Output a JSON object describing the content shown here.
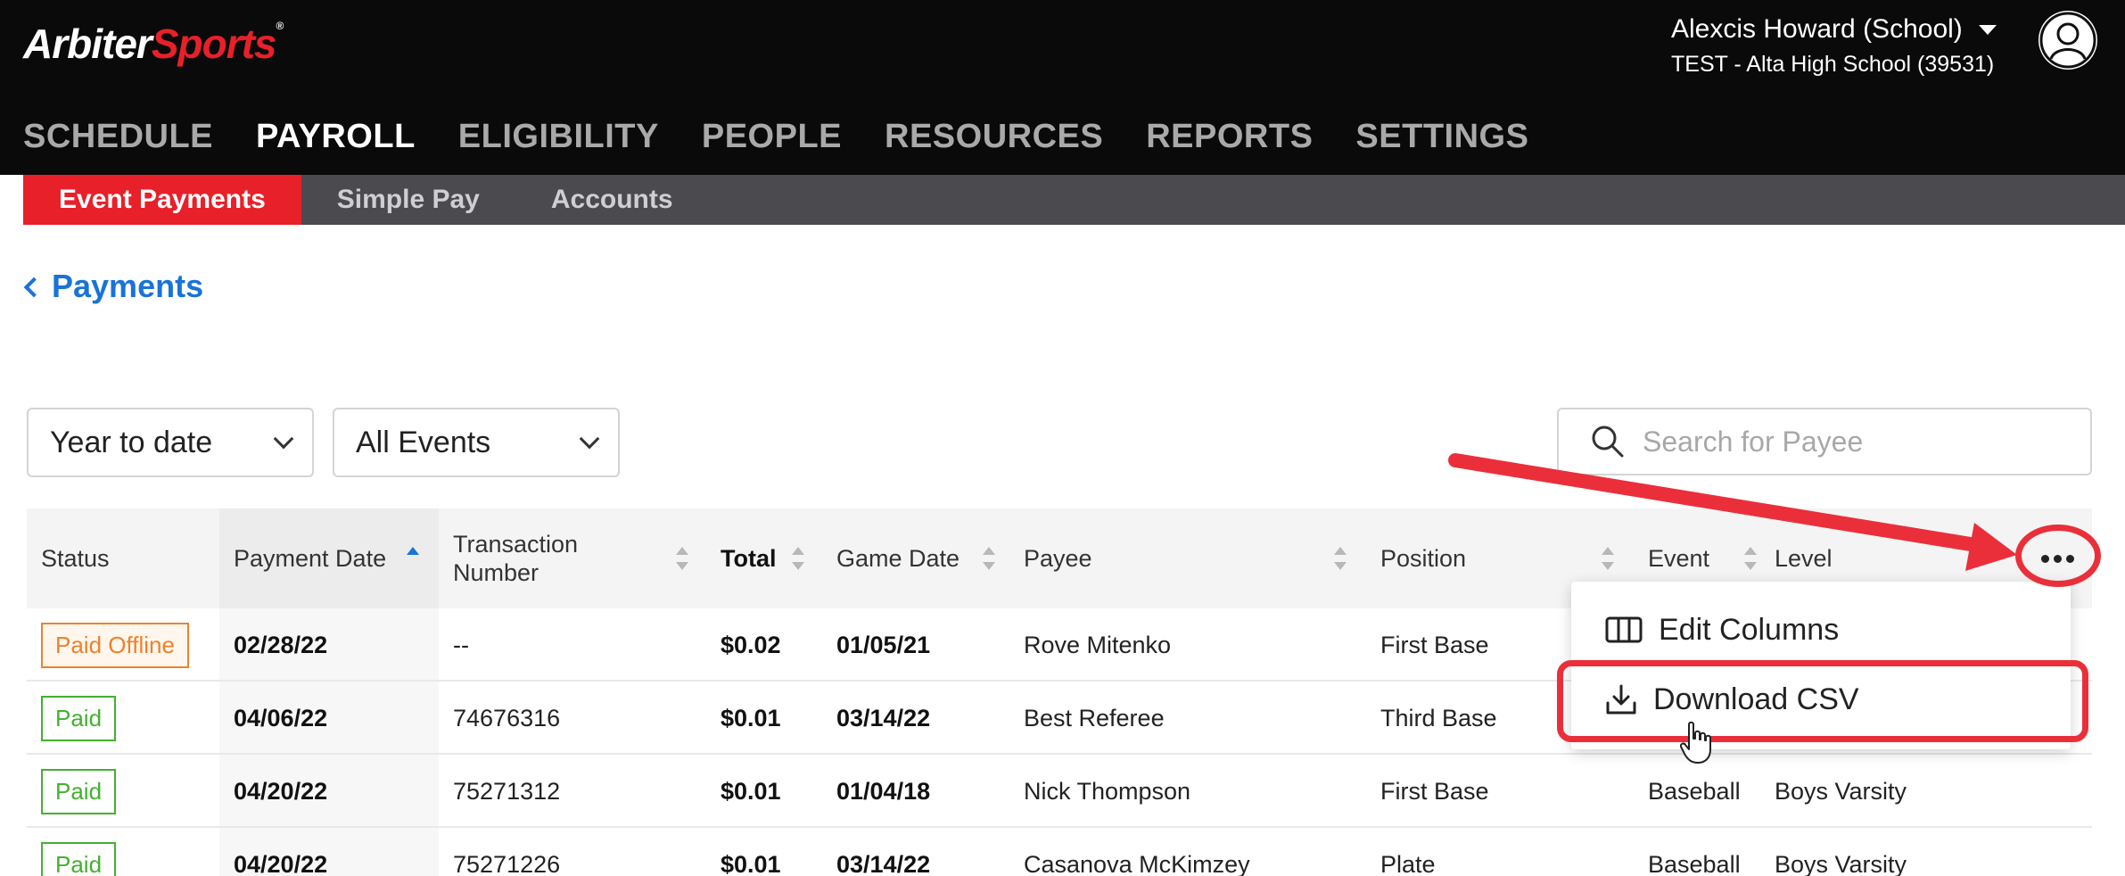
{
  "logo": {
    "part1": "Arbiter",
    "part2": "Sports",
    "mark": "®"
  },
  "user": {
    "name": "Alexcis Howard (School)",
    "school": "TEST - Alta High School (39531)"
  },
  "main_nav": [
    "SCHEDULE",
    "PAYROLL",
    "ELIGIBILITY",
    "PEOPLE",
    "RESOURCES",
    "REPORTS",
    "SETTINGS"
  ],
  "main_nav_active": "PAYROLL",
  "sub_nav": [
    "Event Payments",
    "Simple Pay",
    "Accounts"
  ],
  "sub_nav_active": "Event Payments",
  "breadcrumb": {
    "label": "Payments"
  },
  "filters": {
    "date_range": "Year to date",
    "events": "All Events"
  },
  "search": {
    "placeholder": "Search for Payee"
  },
  "table": {
    "columns": [
      "Status",
      "Payment Date",
      "Transaction Number",
      "Total",
      "Game Date",
      "Payee",
      "Position",
      "Event",
      "Level"
    ],
    "rows": [
      {
        "status": "Paid Offline",
        "payment_date": "02/28/22",
        "transaction": "--",
        "total": "$0.02",
        "game_date": "01/05/21",
        "payee": "Rove Mitenko",
        "position": "First Base",
        "event": "",
        "level": ""
      },
      {
        "status": "Paid",
        "payment_date": "04/06/22",
        "transaction": "74676316",
        "total": "$0.01",
        "game_date": "03/14/22",
        "payee": "Best Referee",
        "position": "Third Base",
        "event": "",
        "level": ""
      },
      {
        "status": "Paid",
        "payment_date": "04/20/22",
        "transaction": "75271312",
        "total": "$0.01",
        "game_date": "01/04/18",
        "payee": "Nick Thompson",
        "position": "First Base",
        "event": "Baseball",
        "level": "Boys Varsity"
      },
      {
        "status": "Paid",
        "payment_date": "04/20/22",
        "transaction": "75271226",
        "total": "$0.01",
        "game_date": "03/14/22",
        "payee": "Casanova McKimzey",
        "position": "Plate",
        "event": "Baseball",
        "level": "Boys Varsity"
      }
    ]
  },
  "menu": {
    "edit_columns": "Edit Columns",
    "download_csv": "Download CSV"
  },
  "colors": {
    "brand_red": "#e8202a",
    "link_blue": "#1a73d9",
    "annotation_red": "#ea2f3a",
    "paid_green": "#43b12e",
    "offline_orange": "#f0802a"
  },
  "icons": [
    "user-avatar-icon",
    "caret-down-icon",
    "chevron-left-icon",
    "chevron-down-icon",
    "search-icon",
    "sort-icon",
    "more-options-icon",
    "columns-icon",
    "download-icon",
    "hand-cursor-icon"
  ]
}
